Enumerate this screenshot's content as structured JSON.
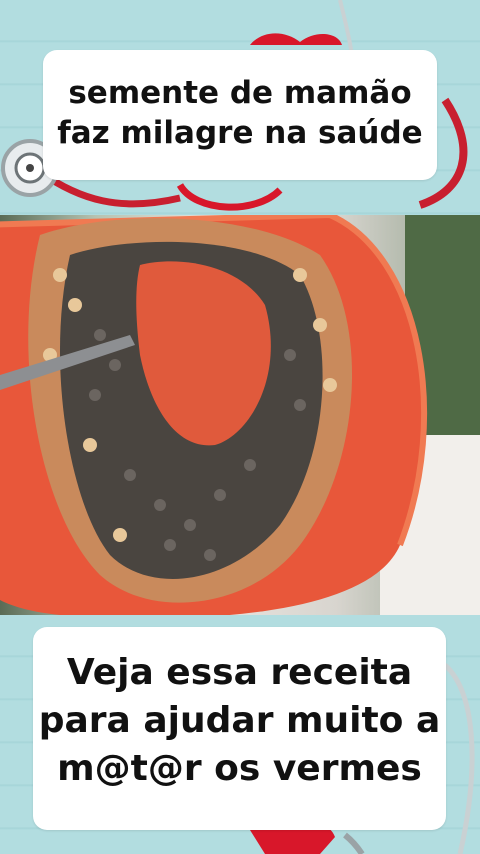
{
  "top_caption": {
    "line1": "semente de mamão",
    "line2": "faz milagre na saúde"
  },
  "bottom_caption": {
    "line1": "Veja essa receita",
    "line2": "para ajudar muito a",
    "line3": "m@t@r os vermes"
  },
  "colors": {
    "background": "#b2dde0",
    "stethoscope": "#d8172a",
    "papaya_flesh": "#e8573a",
    "seeds": "#4a4540",
    "caption_bg": "#ffffff"
  }
}
